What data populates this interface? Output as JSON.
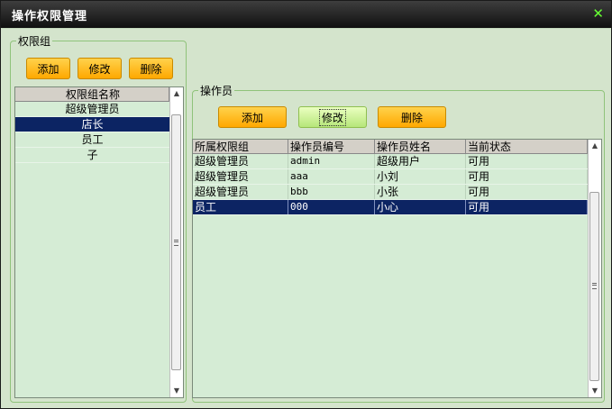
{
  "window": {
    "title": "操作权限管理",
    "close_glyph": "✕"
  },
  "perm_group": {
    "legend": "权限组",
    "buttons": {
      "add": "添加",
      "edit": "修改",
      "delete": "删除"
    },
    "list_header": "权限组名称",
    "items": [
      "超级管理员",
      "店长",
      "员工",
      "子"
    ],
    "selected_index": 1
  },
  "operators": {
    "legend": "操作员",
    "buttons": {
      "add": "添加",
      "edit": "修改",
      "delete": "删除"
    },
    "columns": [
      "所属权限组",
      "操作员编号",
      "操作员姓名",
      "当前状态"
    ],
    "rows": [
      [
        "超级管理员",
        "admin",
        "超级用户",
        "可用"
      ],
      [
        "超级管理员",
        "aaa",
        "小刘",
        "可用"
      ],
      [
        "超级管理员",
        "bbb",
        "小张",
        "可用"
      ],
      [
        "员工",
        "000",
        "小心",
        "可用"
      ]
    ],
    "selected_index": 3
  },
  "colors": {
    "accent_selection": "#0c2463",
    "button_orange": "#ffa800",
    "button_green": "#b6e67a",
    "panel_bg": "#d4e4cc"
  },
  "icons": {
    "scroll_up": "▲",
    "scroll_down": "▼"
  }
}
